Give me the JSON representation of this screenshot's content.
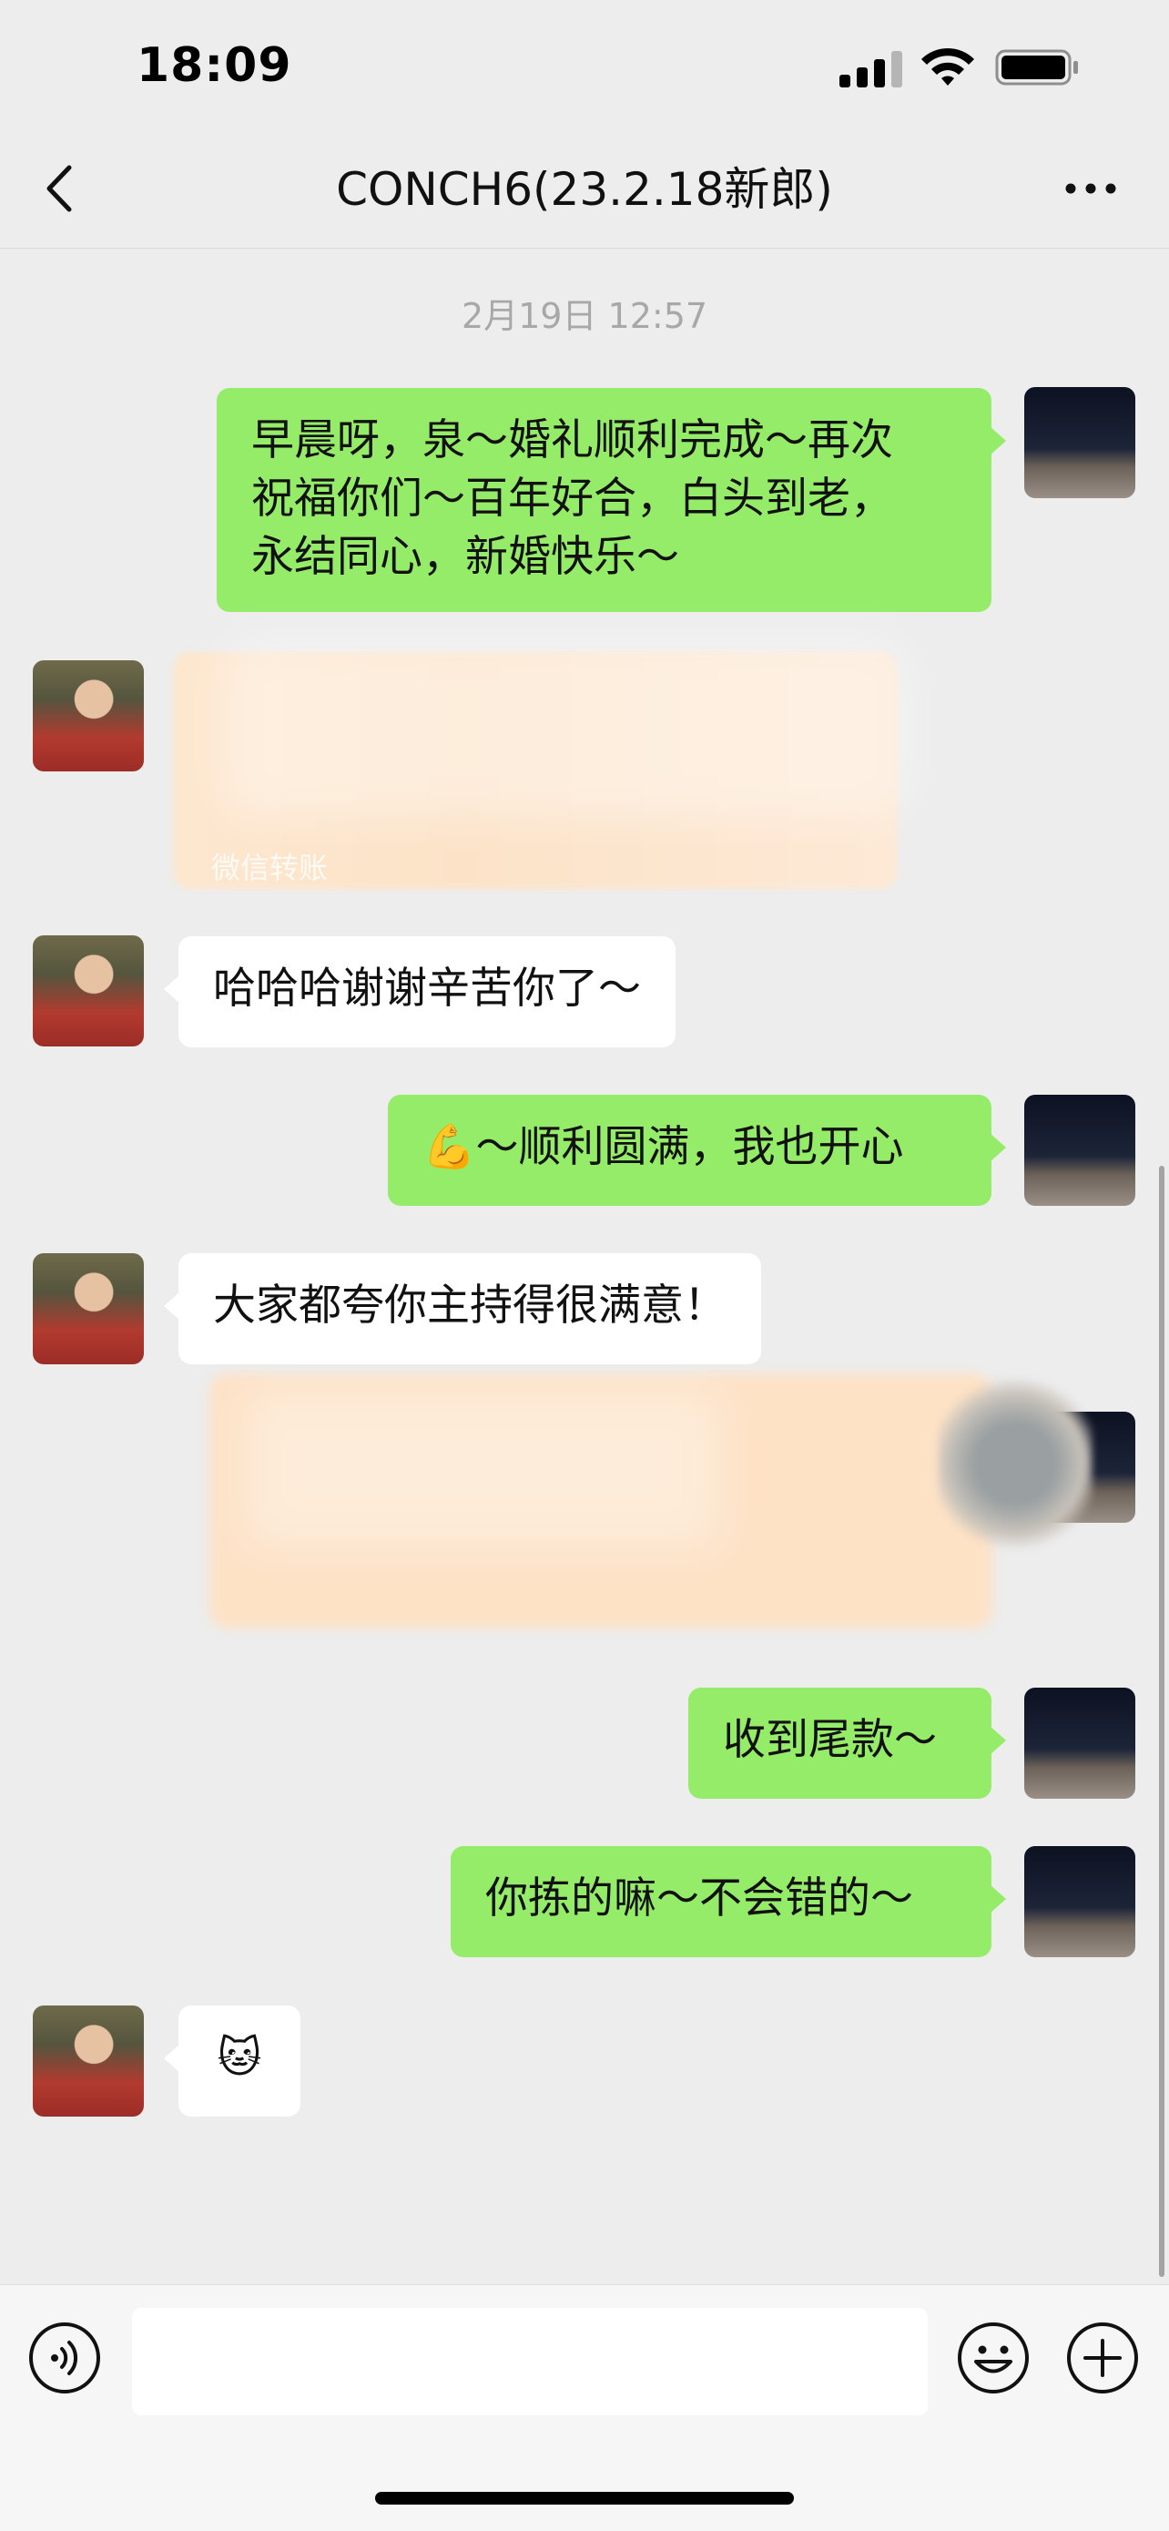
{
  "status_bar": {
    "time": "18:09"
  },
  "header": {
    "title": "CONCH6(23.2.18新郎)"
  },
  "timestamp": "2月19日 12:57",
  "messages": [
    {
      "sender": "me",
      "type": "text",
      "text": "早晨呀，泉～婚礼顺利完成～再次\n祝福你们～百年好合，白头到老，\n永结同心，新婚快乐～"
    },
    {
      "sender": "other",
      "type": "transfer",
      "label": "微信转账"
    },
    {
      "sender": "other",
      "type": "text",
      "text": "哈哈哈谢谢辛苦你了～"
    },
    {
      "sender": "me",
      "type": "text",
      "text": "💪～顺利圆满，我也开心"
    },
    {
      "sender": "other",
      "type": "text",
      "text": "大家都夸你主持得很满意！"
    },
    {
      "sender": "me",
      "type": "redacted"
    },
    {
      "sender": "me",
      "type": "text",
      "text": "收到尾款～"
    },
    {
      "sender": "me",
      "type": "text",
      "text": "你拣的嘛～不会错的～"
    },
    {
      "sender": "other",
      "type": "emoji",
      "text": "🐱"
    }
  ],
  "input": {
    "value": "",
    "placeholder": ""
  },
  "colors": {
    "background": "#ededed",
    "bubble_me": "#95ec69",
    "bubble_other": "#ffffff"
  },
  "icons": [
    "back-chevron-icon",
    "more-dots-icon",
    "voice-icon",
    "emoji-smile-icon",
    "plus-icon"
  ]
}
